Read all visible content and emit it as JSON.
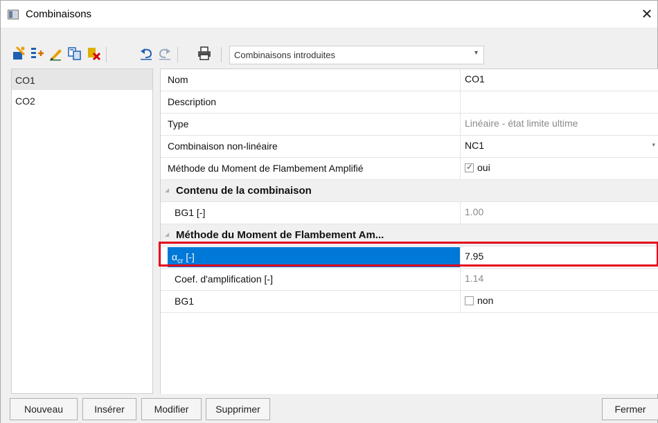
{
  "window": {
    "title": "Combinaisons",
    "close_glyph": "✕"
  },
  "toolbar": {
    "icons": [
      "new-icon",
      "insert-icon",
      "edit-icon",
      "copy-icon",
      "delete-icon",
      "undo-icon",
      "redo-icon",
      "print-icon"
    ],
    "combo_value": "Combinaisons introduites"
  },
  "list": {
    "items": [
      "CO1",
      "CO2"
    ],
    "selected": "CO1"
  },
  "grid": {
    "nom_label": "Nom",
    "nom_value": "CO1",
    "description_label": "Description",
    "description_value": "",
    "type_label": "Type",
    "type_value": "Linéaire - état limite ultime",
    "nonlin_label": "Combinaison non-linéaire",
    "nonlin_value": "NC1",
    "method_label": "Méthode du Moment de Flambement Amplifié",
    "method_value": "oui",
    "method_checked": true,
    "cat1_label": "Contenu de la combinaison",
    "bg1_label": "BG1 [-]",
    "bg1_value": "1.00",
    "cat2_label": "Méthode du Moment de Flambement Am...",
    "alpha_symbol": "α",
    "alpha_sub": "cr",
    "alpha_unit": " [-]",
    "alpha_value": "7.95",
    "coef_label": "Coef. d'amplification [-]",
    "coef_value": "1.14",
    "bg1b_label": "BG1",
    "bg1b_value": "non",
    "bg1b_checked": false
  },
  "buttons": {
    "nouveau": "Nouveau",
    "inserer": "Insérer",
    "modifier": "Modifier",
    "supprimer": "Supprimer",
    "fermer": "Fermer"
  },
  "colors": {
    "selection": "#0078d7",
    "highlight": "#e3001b"
  }
}
